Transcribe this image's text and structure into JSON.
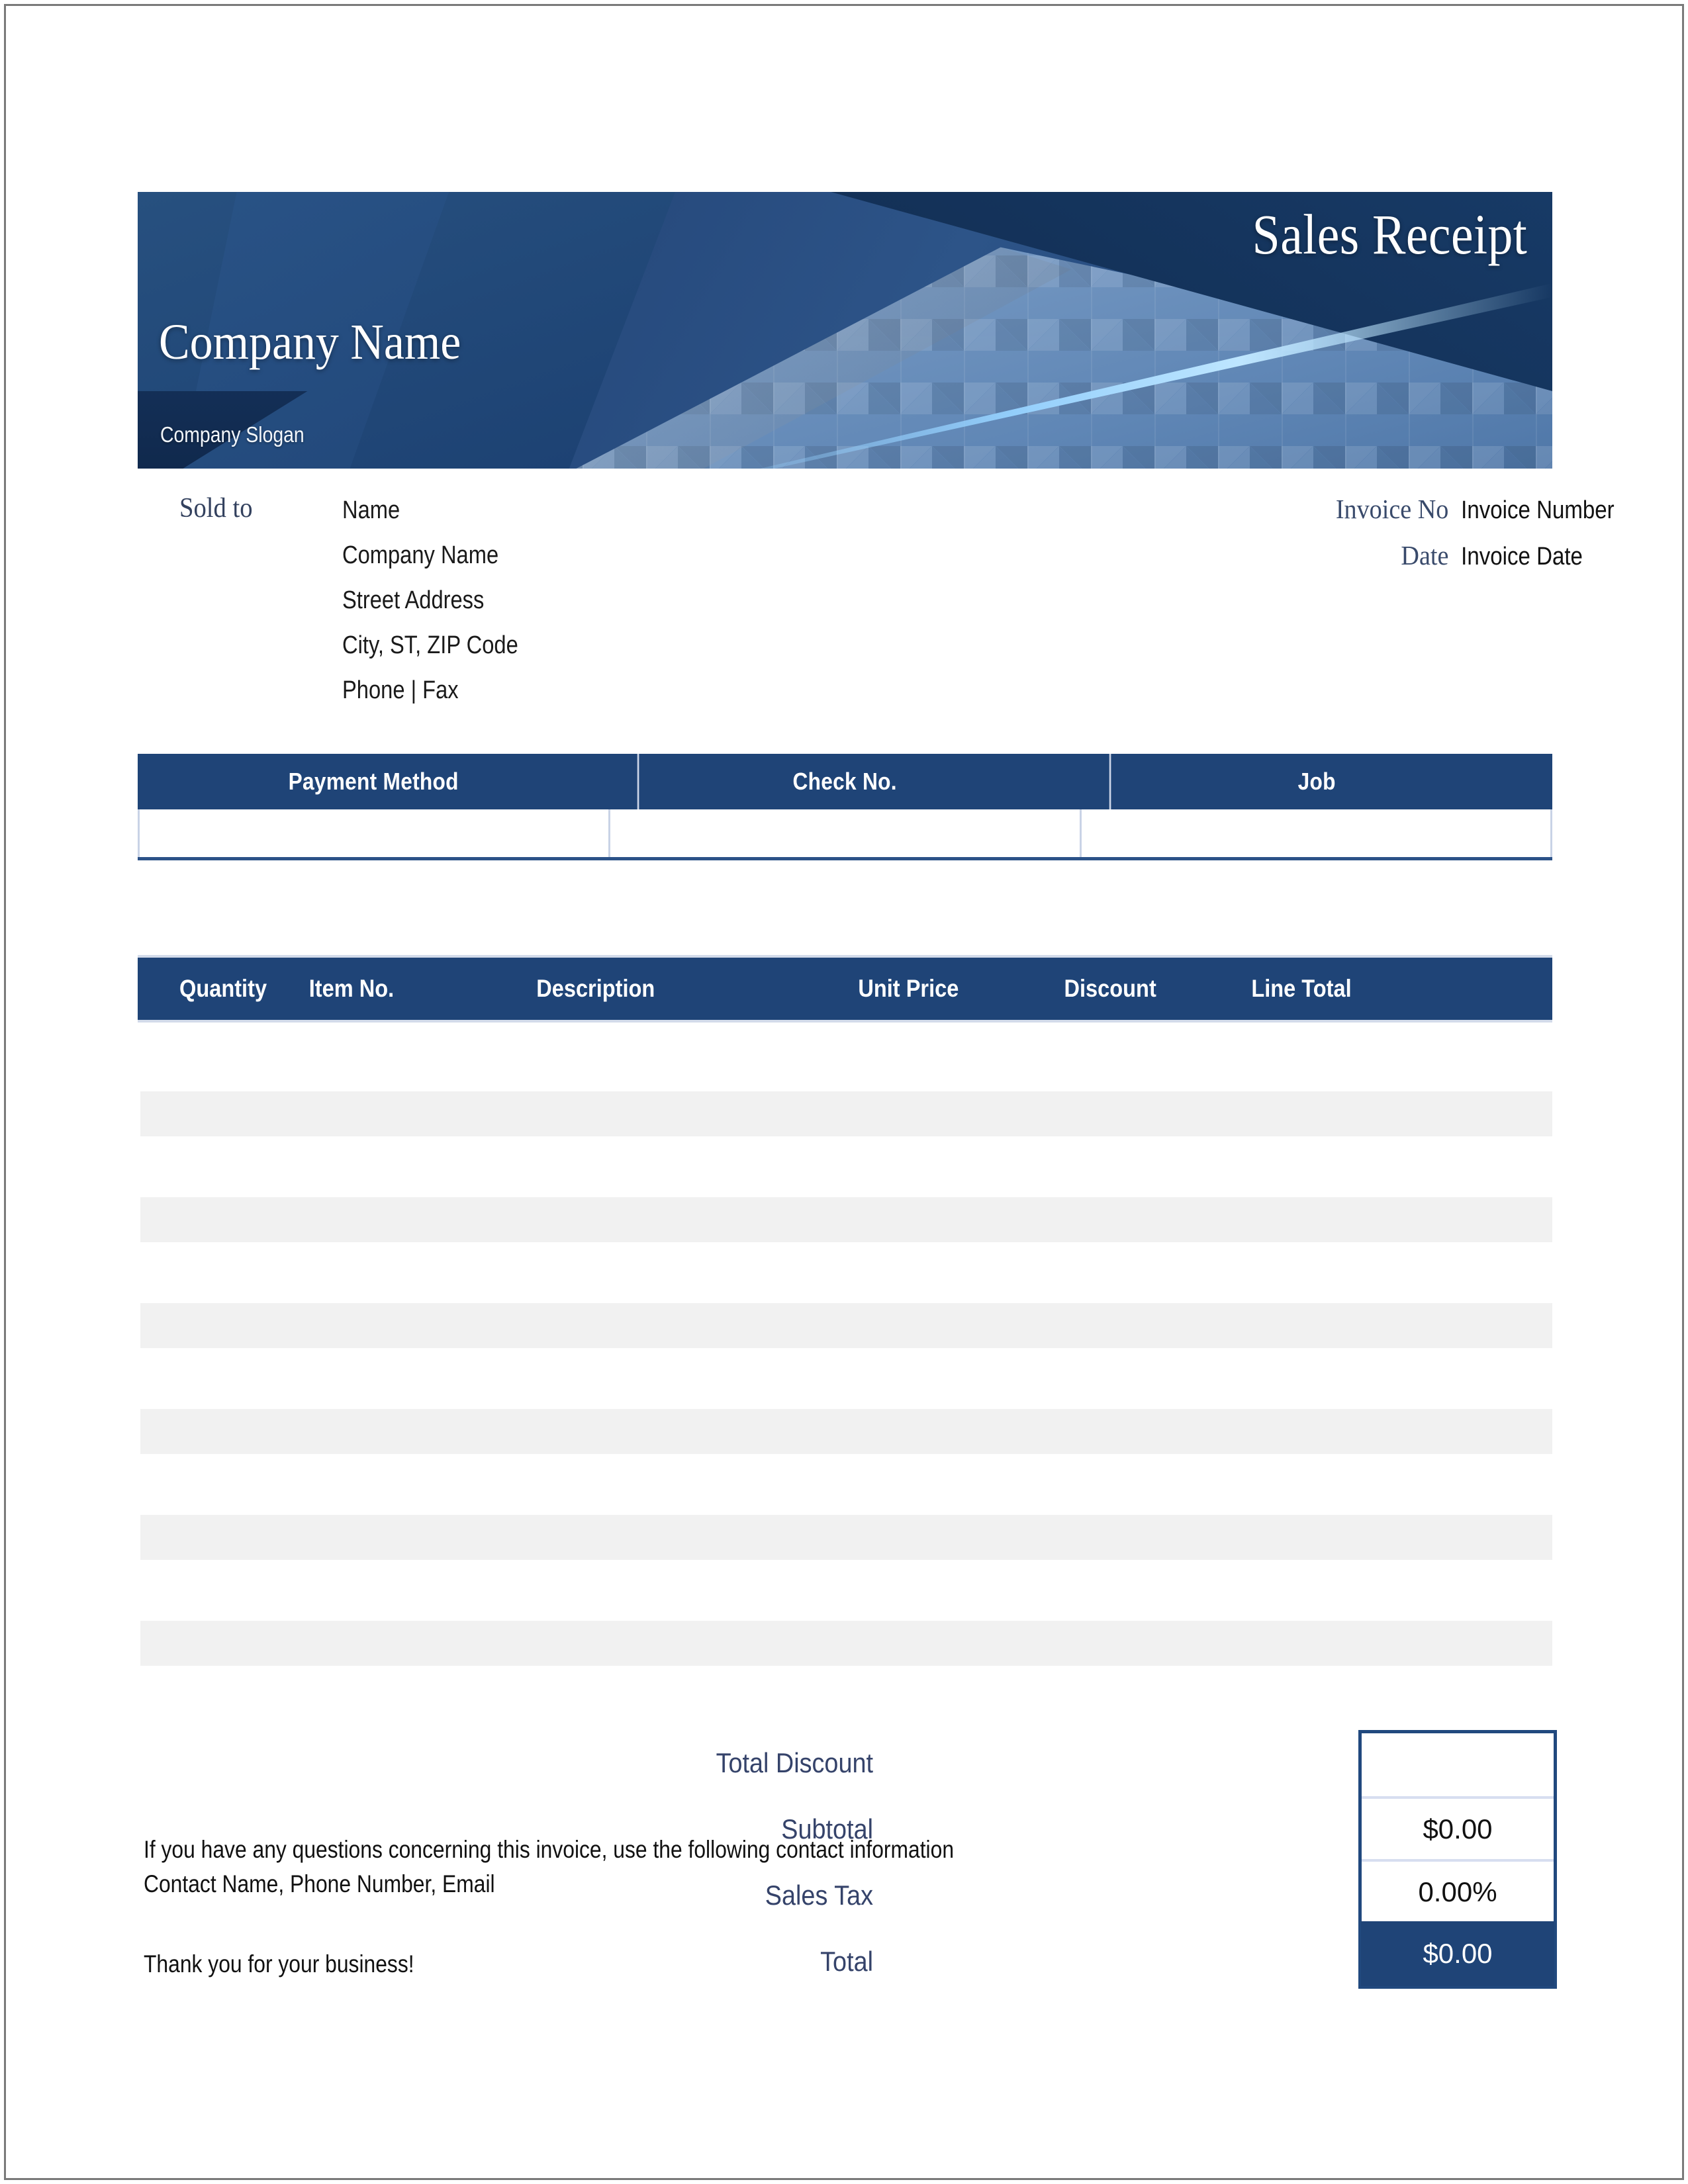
{
  "document": {
    "title": "Sales Receipt",
    "company_name": "Company Name",
    "company_slogan": "Company Slogan"
  },
  "sold_to": {
    "label": "Sold to",
    "lines": [
      "Name",
      "Company Name",
      "Street Address",
      "City, ST,  ZIP Code",
      "Phone | Fax"
    ]
  },
  "invoice_meta": [
    {
      "label": "Invoice No",
      "value": "Invoice Number"
    },
    {
      "label": "Date",
      "value": "Invoice Date"
    }
  ],
  "payment_table": {
    "headers": [
      "Payment Method",
      "Check No.",
      "Job"
    ],
    "row": [
      "",
      "",
      ""
    ]
  },
  "items_table": {
    "headers": [
      "Quantity",
      "Item No.",
      "Description",
      "Unit Price",
      "Discount",
      "Line Total"
    ],
    "rows": [
      [],
      [],
      [],
      [],
      [],
      []
    ]
  },
  "totals": [
    {
      "label": "Total Discount",
      "value": ""
    },
    {
      "label": "Subtotal",
      "value": "$0.00"
    },
    {
      "label": "Sales Tax",
      "value": "0.00%"
    },
    {
      "label": "Total",
      "value": "$0.00"
    }
  ],
  "footer": {
    "contact_line": "If you have any questions concerning this invoice, use the following contact information",
    "contact_details": "Contact Name, Phone Number, Email",
    "thanks": "Thank you for your business!"
  },
  "colors": {
    "primary_dark_blue": "#1f4477",
    "border_blue": "#21497e",
    "label_blue": "#35436a",
    "stripe_gray": "#f1f1f1",
    "divider": "#c9d3e6"
  }
}
